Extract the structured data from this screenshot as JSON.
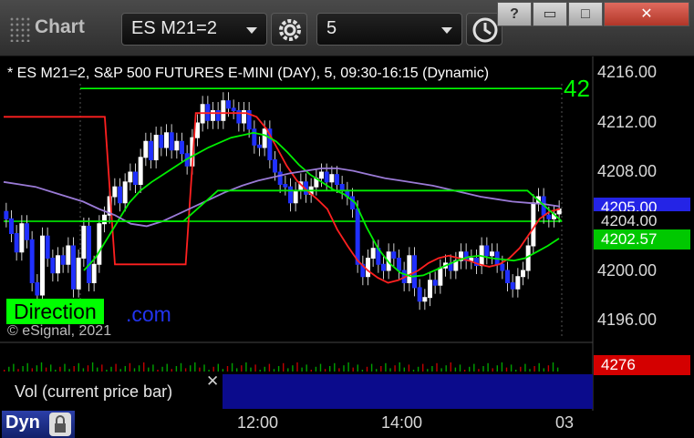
{
  "window": {
    "title": "Chart",
    "symbol": "ES M21=2",
    "interval": "5",
    "buttons": [
      "?",
      "▭",
      "□",
      "✕"
    ]
  },
  "chart_header": "* ES M21=2, S&P 500 FUTURES E-MINI (DAY), 5, 09:30-16:15 (Dynamic)",
  "right_edge_value": "42",
  "watermark": "© eSignal, 2021",
  "brand": {
    "direction": "Direction",
    "dotcom": ".com"
  },
  "price_labels": [
    "4216.00",
    "4212.00",
    "4208.00",
    "4200.00",
    "4196.00"
  ],
  "price_boxes": [
    {
      "label": "4205.00",
      "color": "#2424e6"
    },
    {
      "label": "4204.00",
      "color": "#d0d0d0"
    },
    {
      "label": "4202.57",
      "color": "#00c800"
    }
  ],
  "volume": {
    "label": "Vol (current price bar)",
    "value": "4276",
    "value_color": "#d40000"
  },
  "time_labels": [
    "12:00",
    "14:00",
    "03"
  ],
  "dyn_label": "Dyn",
  "chart_data": {
    "type": "candlestick",
    "title": "* ES M21=2, S&P 500 FUTURES E-MINI (DAY), 5, 09:30-16:15 (Dynamic)",
    "y_range": [
      4194,
      4218
    ],
    "y_ticks": [
      4216,
      4212,
      4208,
      4204,
      4200,
      4196
    ],
    "x_ticks": [
      "12:00",
      "14:00",
      "03"
    ],
    "horizontal_levels": [
      {
        "name": "upper green level",
        "value": 4214.8,
        "color": "#00ff00"
      },
      {
        "name": "lower green level",
        "value": 4204.0,
        "color": "#00ff00"
      }
    ],
    "bars_close": [
      4204.2,
      4203.0,
      4201.5,
      4203.8,
      4202.5,
      4199.0,
      4198.0,
      4202.8,
      4201.0,
      4199.8,
      4201.2,
      4200.5,
      4202.0,
      4198.5,
      4201.0,
      4203.6,
      4199.0,
      4200.5,
      4203.8,
      4204.5,
      4206.0,
      4206.8,
      4205.5,
      4207.2,
      4208.0,
      4207.0,
      4209.2,
      4210.5,
      4209.0,
      4211.0,
      4210.0,
      4211.2,
      4209.8,
      4210.5,
      4209.5,
      4208.5,
      4210.8,
      4212.0,
      4213.5,
      4212.2,
      4213.0,
      4212.2,
      4213.8,
      4213.2,
      4213.0,
      4212.0,
      4213.0,
      4211.5,
      4210.2,
      4210.0,
      4211.5,
      4209.0,
      4208.0,
      4207.0,
      4206.8,
      4205.5,
      4206.5,
      4207.2,
      4206.2,
      4206.8,
      4207.5,
      4208.0,
      4207.2,
      4207.8,
      4207.0,
      4206.5,
      4206.0,
      4205.0,
      4200.5,
      4199.5,
      4201.0,
      4201.8,
      4200.5,
      4200.0,
      4201.5,
      4201.0,
      4200.0,
      4199.0,
      4201.2,
      4198.6,
      4197.5,
      4197.8,
      4199.2,
      4198.8,
      4200.2,
      4200.6,
      4200.0,
      4200.8,
      4201.5,
      4200.8,
      4201.0,
      4200.4,
      4202.0,
      4201.2,
      4201.5,
      4200.5,
      4200.0,
      4199.0,
      4198.5,
      4199.5,
      4200.0,
      4202.0,
      4205.5,
      4206.0,
      4204.5,
      4204.2,
      4204.6,
      4205.0
    ],
    "series": [
      {
        "name": "red line",
        "color": "#ff2020",
        "values": [
          4212.5,
          4212.5,
          4212.5,
          4212.5,
          4212.5,
          4212.5,
          4212.5,
          4212.5,
          4212.5,
          4212.5,
          4212.5,
          4200.5,
          4200.5,
          4200.5,
          4200.5,
          4200.5,
          4200.5,
          4200.5,
          4200.5,
          4212.8,
          4212.8,
          4212.8,
          4212.8,
          4212.8,
          4212.8,
          4212.5,
          4211.5,
          4210.0,
          4208.5,
          4207.3,
          4206.5,
          4205.8,
          4205.0,
          4203.3,
          4202.0,
          4200.8,
          4200.0,
          4199.4,
          4199.0,
          4199.2,
          4199.6,
          4200.0,
          4200.6,
          4201.0,
          4201.2,
          4201.0,
          4200.8,
          4200.5,
          4200.3,
          4200.5,
          4201.0,
          4201.8,
          4203.0,
          4204.2,
          4204.8,
          4205.0
        ]
      },
      {
        "name": "green average",
        "color": "#00ee00",
        "values": [
          4200.0,
          4201.0,
          4202.5,
          4204.0,
          4205.5,
          4206.5,
          4207.2,
          4207.8,
          4208.4,
          4209.0,
          4209.5,
          4210.0,
          4210.4,
          4210.8,
          4211.0,
          4211.2,
          4211.0,
          4210.5,
          4209.6,
          4208.6,
          4207.8,
          4207.2,
          4206.6,
          4206.2,
          4205.5,
          4203.5,
          4201.8,
          4200.6,
          4199.8,
          4199.5,
          4199.6,
          4200.0,
          4200.4,
          4200.8,
          4201.1,
          4201.2,
          4201.0,
          4200.9,
          4200.8,
          4201.0,
          4201.5,
          4202.0,
          4202.6
        ]
      },
      {
        "name": "purple average",
        "color": "#9a7ad6",
        "values": [
          4207.2,
          4207.0,
          4206.8,
          4206.4,
          4206.0,
          4205.6,
          4205.0,
          4204.5,
          4203.8,
          4203.6,
          4204.0,
          4204.6,
          4205.2,
          4205.8,
          4206.4,
          4206.9,
          4207.3,
          4207.6,
          4207.9,
          4208.1,
          4208.3,
          4208.3,
          4208.1,
          4207.8,
          4207.5,
          4207.3,
          4207.1,
          4206.9,
          4206.6,
          4206.3,
          4206.0,
          4205.8,
          4205.6,
          4205.5,
          4205.4,
          4205.2
        ]
      },
      {
        "name": "green step line",
        "color": "#00ee00",
        "values": [
          4204.0,
          4204.0,
          4204.0,
          4204.0,
          4206.5,
          4206.5,
          4206.5,
          4206.5,
          4206.5,
          4206.5,
          4206.5,
          4206.5,
          4206.5,
          4206.5,
          4204.0
        ]
      }
    ]
  }
}
